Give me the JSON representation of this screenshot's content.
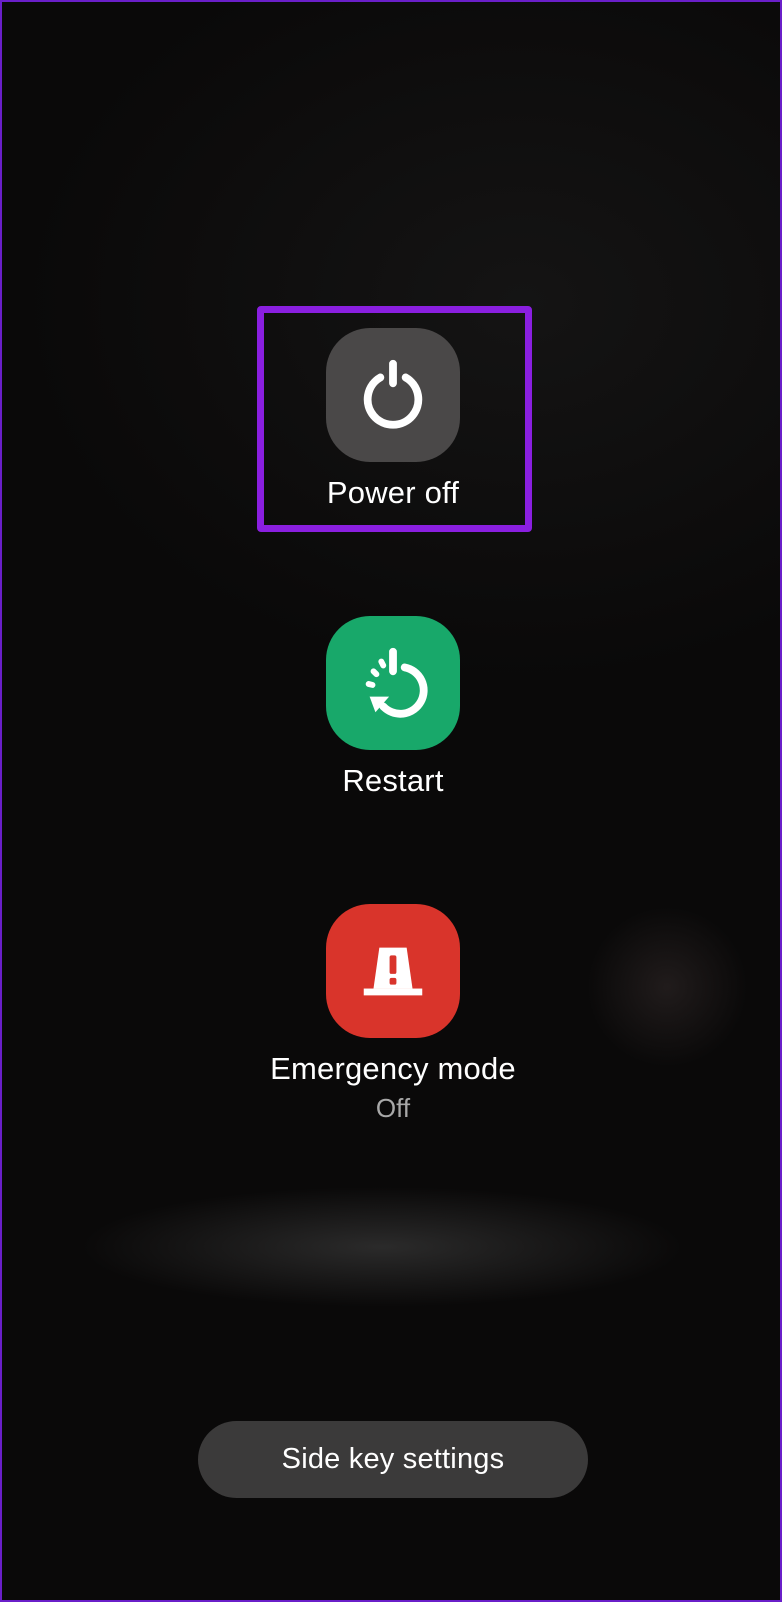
{
  "power_menu": {
    "power_off": {
      "label": "Power off",
      "icon": "power-icon",
      "color": "#4a4848"
    },
    "restart": {
      "label": "Restart",
      "icon": "restart-icon",
      "color": "#18a86a"
    },
    "emergency": {
      "label": "Emergency mode",
      "status": "Off",
      "icon": "emergency-siren-icon",
      "color": "#d9342b"
    }
  },
  "side_key_settings": {
    "label": "Side key settings"
  },
  "highlight_color": "#8a1fe0"
}
